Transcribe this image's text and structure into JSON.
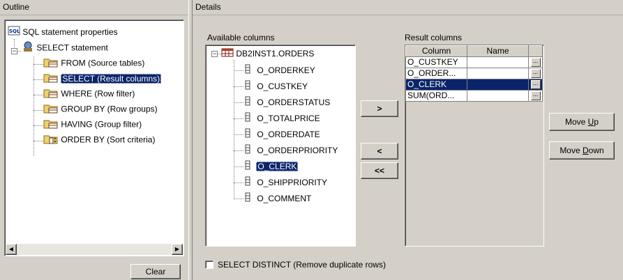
{
  "outline": {
    "title": "Outline",
    "items": [
      {
        "label": "SQL statement properties"
      },
      {
        "label": "SELECT statement"
      },
      {
        "label": "FROM (Source tables)"
      },
      {
        "label": "SELECT (Result columns)"
      },
      {
        "label": "WHERE (Row filter)"
      },
      {
        "label": "GROUP BY (Row groups)"
      },
      {
        "label": "HAVING (Group filter)"
      },
      {
        "label": "ORDER BY (Sort criteria)"
      }
    ],
    "clear_label": "Clear"
  },
  "details": {
    "title": "Details",
    "available_label": "Available columns",
    "table_name": "DB2INST1.ORDERS",
    "columns": [
      "O_ORDERKEY",
      "O_CUSTKEY",
      "O_ORDERSTATUS",
      "O_TOTALPRICE",
      "O_ORDERDATE",
      "O_ORDERPRIORITY",
      "O_CLERK",
      "O_SHIPPRIORITY",
      "O_COMMENT"
    ],
    "selected_column": "O_CLERK",
    "buttons": {
      "add": ">",
      "remove": "<",
      "remove_all": "<<"
    },
    "result_label": "Result columns",
    "result_headers": {
      "column": "Column",
      "name": "Name"
    },
    "result_rows": [
      {
        "column": "O_CUSTKEY",
        "name": ""
      },
      {
        "column": "O_ORDER...",
        "name": ""
      },
      {
        "column": "O_CLERK",
        "name": ""
      },
      {
        "column": "SUM(ORD...",
        "name": ""
      }
    ],
    "move_up": {
      "pre": "Move ",
      "key": "U",
      "post": "p"
    },
    "move_down": {
      "pre": "Move ",
      "key": "D",
      "post": "own"
    },
    "distinct_label": "SELECT DISTINCT (Remove duplicate rows)",
    "distinct_checked": false
  }
}
